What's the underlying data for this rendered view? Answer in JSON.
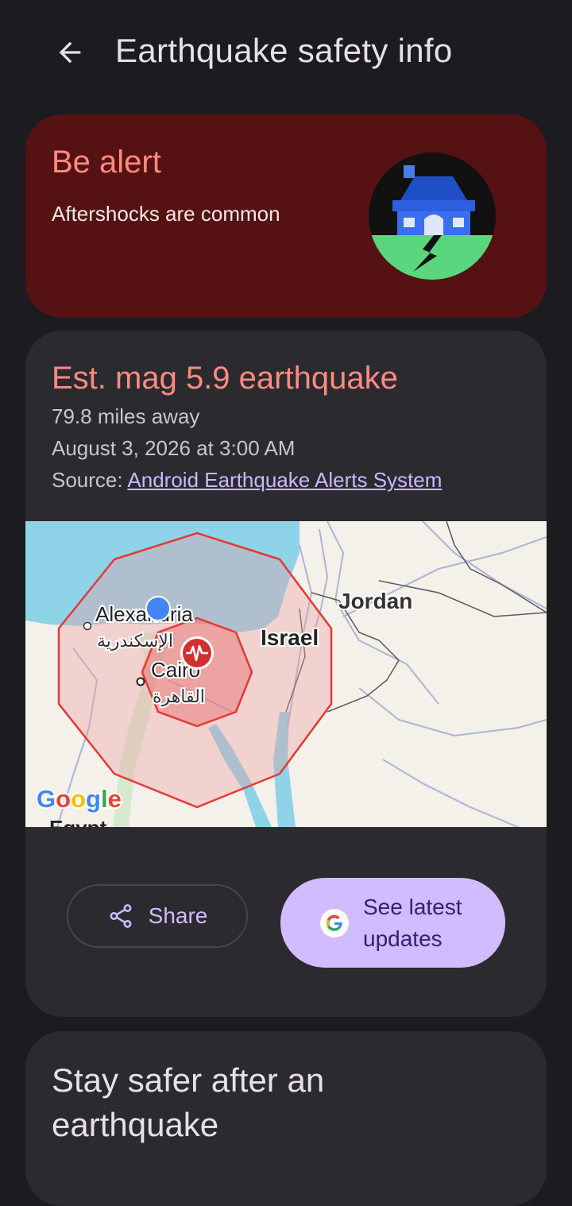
{
  "header": {
    "title": "Earthquake safety info"
  },
  "alert": {
    "title": "Be alert",
    "subtitle": "Aftershocks are common"
  },
  "quake": {
    "title": "Est. mag 5.9 earthquake",
    "distance": "79.8 miles away",
    "datetime": "August 3, 2026 at 3:00 AM",
    "source_prefix": "Source: ",
    "source_link": "Android Earthquake Alerts System"
  },
  "map": {
    "labels": {
      "alexandria": "Alexandria",
      "alexandria_ar": "الإسكندرية",
      "cairo": "Cairo",
      "cairo_ar": "القاهرة",
      "israel": "Israel",
      "jordan": "Jordan",
      "egypt": "Egypt",
      "google": "Google"
    },
    "colors": {
      "sea": "#8fd3e8",
      "land": "#f4f0ea",
      "shake_outer": "#e53935",
      "shake_inner": "#e53935",
      "location_dot": "#4285f4"
    }
  },
  "actions": {
    "share_label": "Share",
    "updates_label": "See latest updates"
  },
  "safety": {
    "title": "Stay safer after an earthquake"
  }
}
